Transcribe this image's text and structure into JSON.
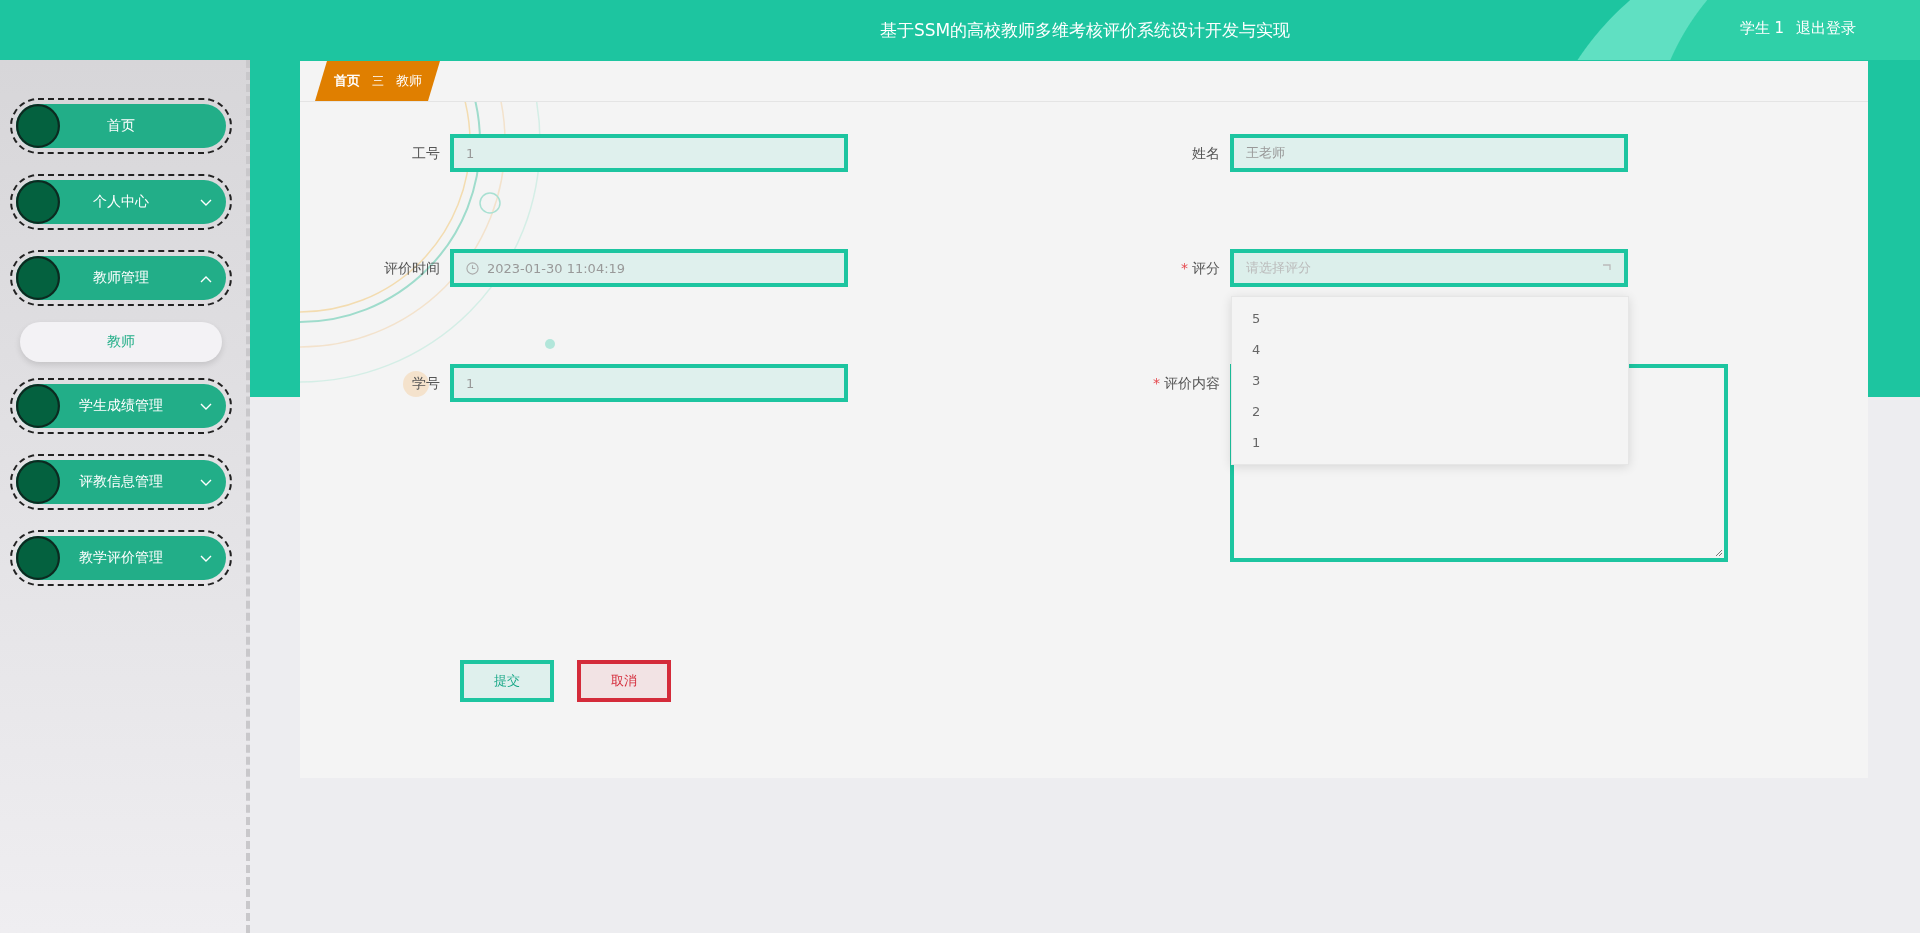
{
  "header": {
    "title": "基于SSM的高校教师多维考核评价系统设计开发与实现",
    "user": "学生 1",
    "logout": "退出登录"
  },
  "sidebar": {
    "items": [
      {
        "label": "首页"
      },
      {
        "label": "个人中心",
        "expanded": false
      },
      {
        "label": "教师管理",
        "expanded": true,
        "children": [
          {
            "label": "教师"
          }
        ]
      },
      {
        "label": "学生成绩管理",
        "expanded": false
      },
      {
        "label": "评教信息管理",
        "expanded": false
      },
      {
        "label": "教学评价管理",
        "expanded": false
      }
    ]
  },
  "breadcrumb": {
    "items": [
      "首页",
      "教师"
    ],
    "separator": "三"
  },
  "form": {
    "fields": [
      {
        "label": "工号",
        "kind": "text",
        "value": "1"
      },
      {
        "label": "姓名",
        "kind": "text",
        "value": "王老师"
      },
      {
        "label": "评价时间",
        "kind": "date",
        "value": "2023-01-30 11:04:19"
      },
      {
        "label": "评分",
        "kind": "select",
        "required_mark": "*",
        "placeholder": "请选择评分",
        "open": true,
        "options": [
          "5",
          "4",
          "3",
          "2",
          "1"
        ]
      },
      {
        "label": "学号",
        "kind": "text",
        "value": "1"
      },
      {
        "label": "评价内容",
        "kind": "textarea",
        "required_mark": "*"
      }
    ],
    "buttons": [
      {
        "label": "提交",
        "kind": "primary"
      },
      {
        "label": "取消",
        "kind": "danger"
      }
    ]
  }
}
